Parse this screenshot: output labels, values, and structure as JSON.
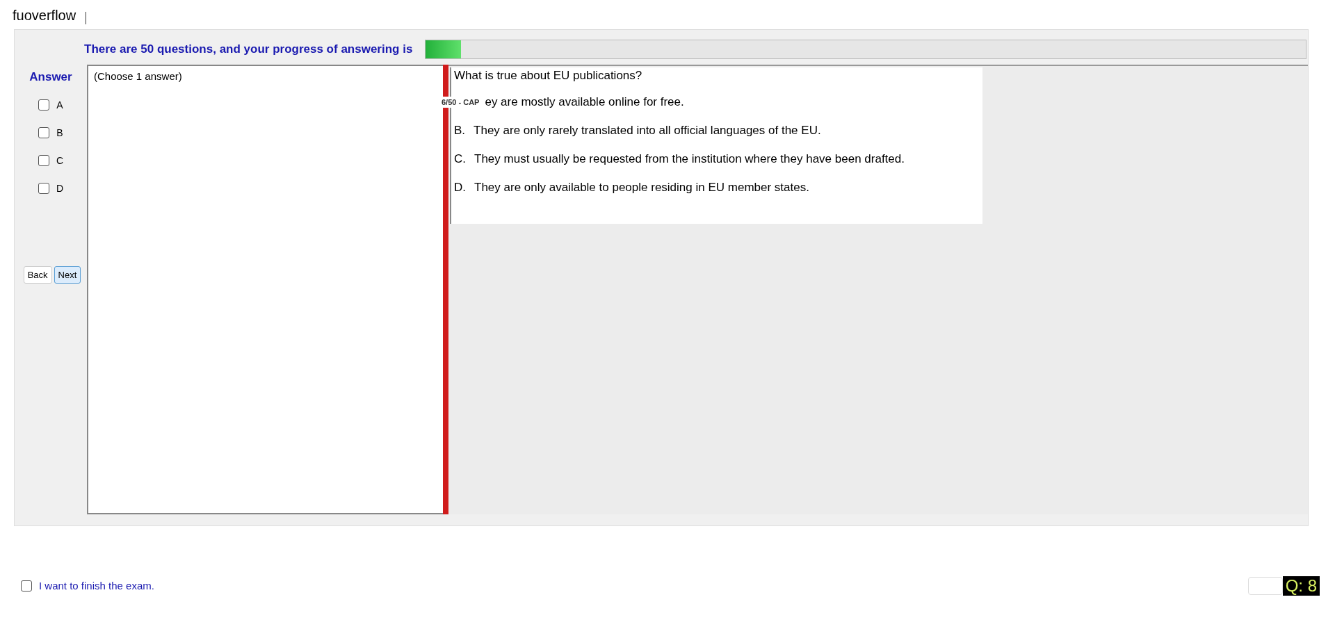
{
  "site_label": "fuoverflow",
  "progress": {
    "text": "There are 50 questions, and your progress of answering is",
    "level": 0.04
  },
  "answer_panel": {
    "title": "Answer",
    "choices": [
      {
        "label": "A",
        "checked": false
      },
      {
        "label": "B",
        "checked": false
      },
      {
        "label": "C",
        "checked": false
      },
      {
        "label": "D",
        "checked": false
      }
    ],
    "buttons": [
      {
        "label": "Back",
        "selected": false
      },
      {
        "label": "Next",
        "selected": true
      }
    ]
  },
  "note": {
    "text": "(Choose 1 answer)"
  },
  "question": {
    "text": "What is true about EU publications?",
    "overlay_label": "6/50 - CAP",
    "options": [
      {
        "text": "ey are mostly available online for free."
      },
      {
        "letter": "B.",
        "text": "They are only rarely translated into all official languages of the EU."
      },
      {
        "letter": "C.",
        "text": "They must usually be requested from the institution where they have been drafted."
      },
      {
        "letter": "D.",
        "text": "They are only available to people residing in EU member states."
      }
    ]
  },
  "finish": {
    "label": "I want to finish the exam.",
    "checked": false
  },
  "question_counter": "Q: 8"
}
